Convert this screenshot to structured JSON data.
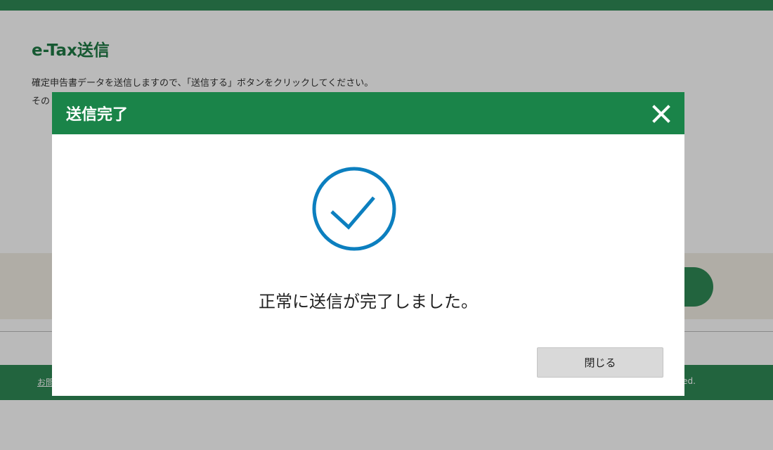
{
  "page": {
    "title": "e-Tax送信",
    "description_line1": "確定申告書データを送信しますので、「送信する」ボタンをクリックしてください。",
    "description_line2": "その"
  },
  "footer": {
    "link": "お問",
    "copyright": "ed."
  },
  "modal": {
    "title": "送信完了",
    "message": "正常に送信が完了しました。",
    "close_button_label": "閉じる"
  },
  "colors": {
    "brand_green": "#1a8449",
    "check_blue": "#0c7fbf"
  },
  "icons": {
    "close": "close-icon",
    "success": "check-circle-icon"
  }
}
